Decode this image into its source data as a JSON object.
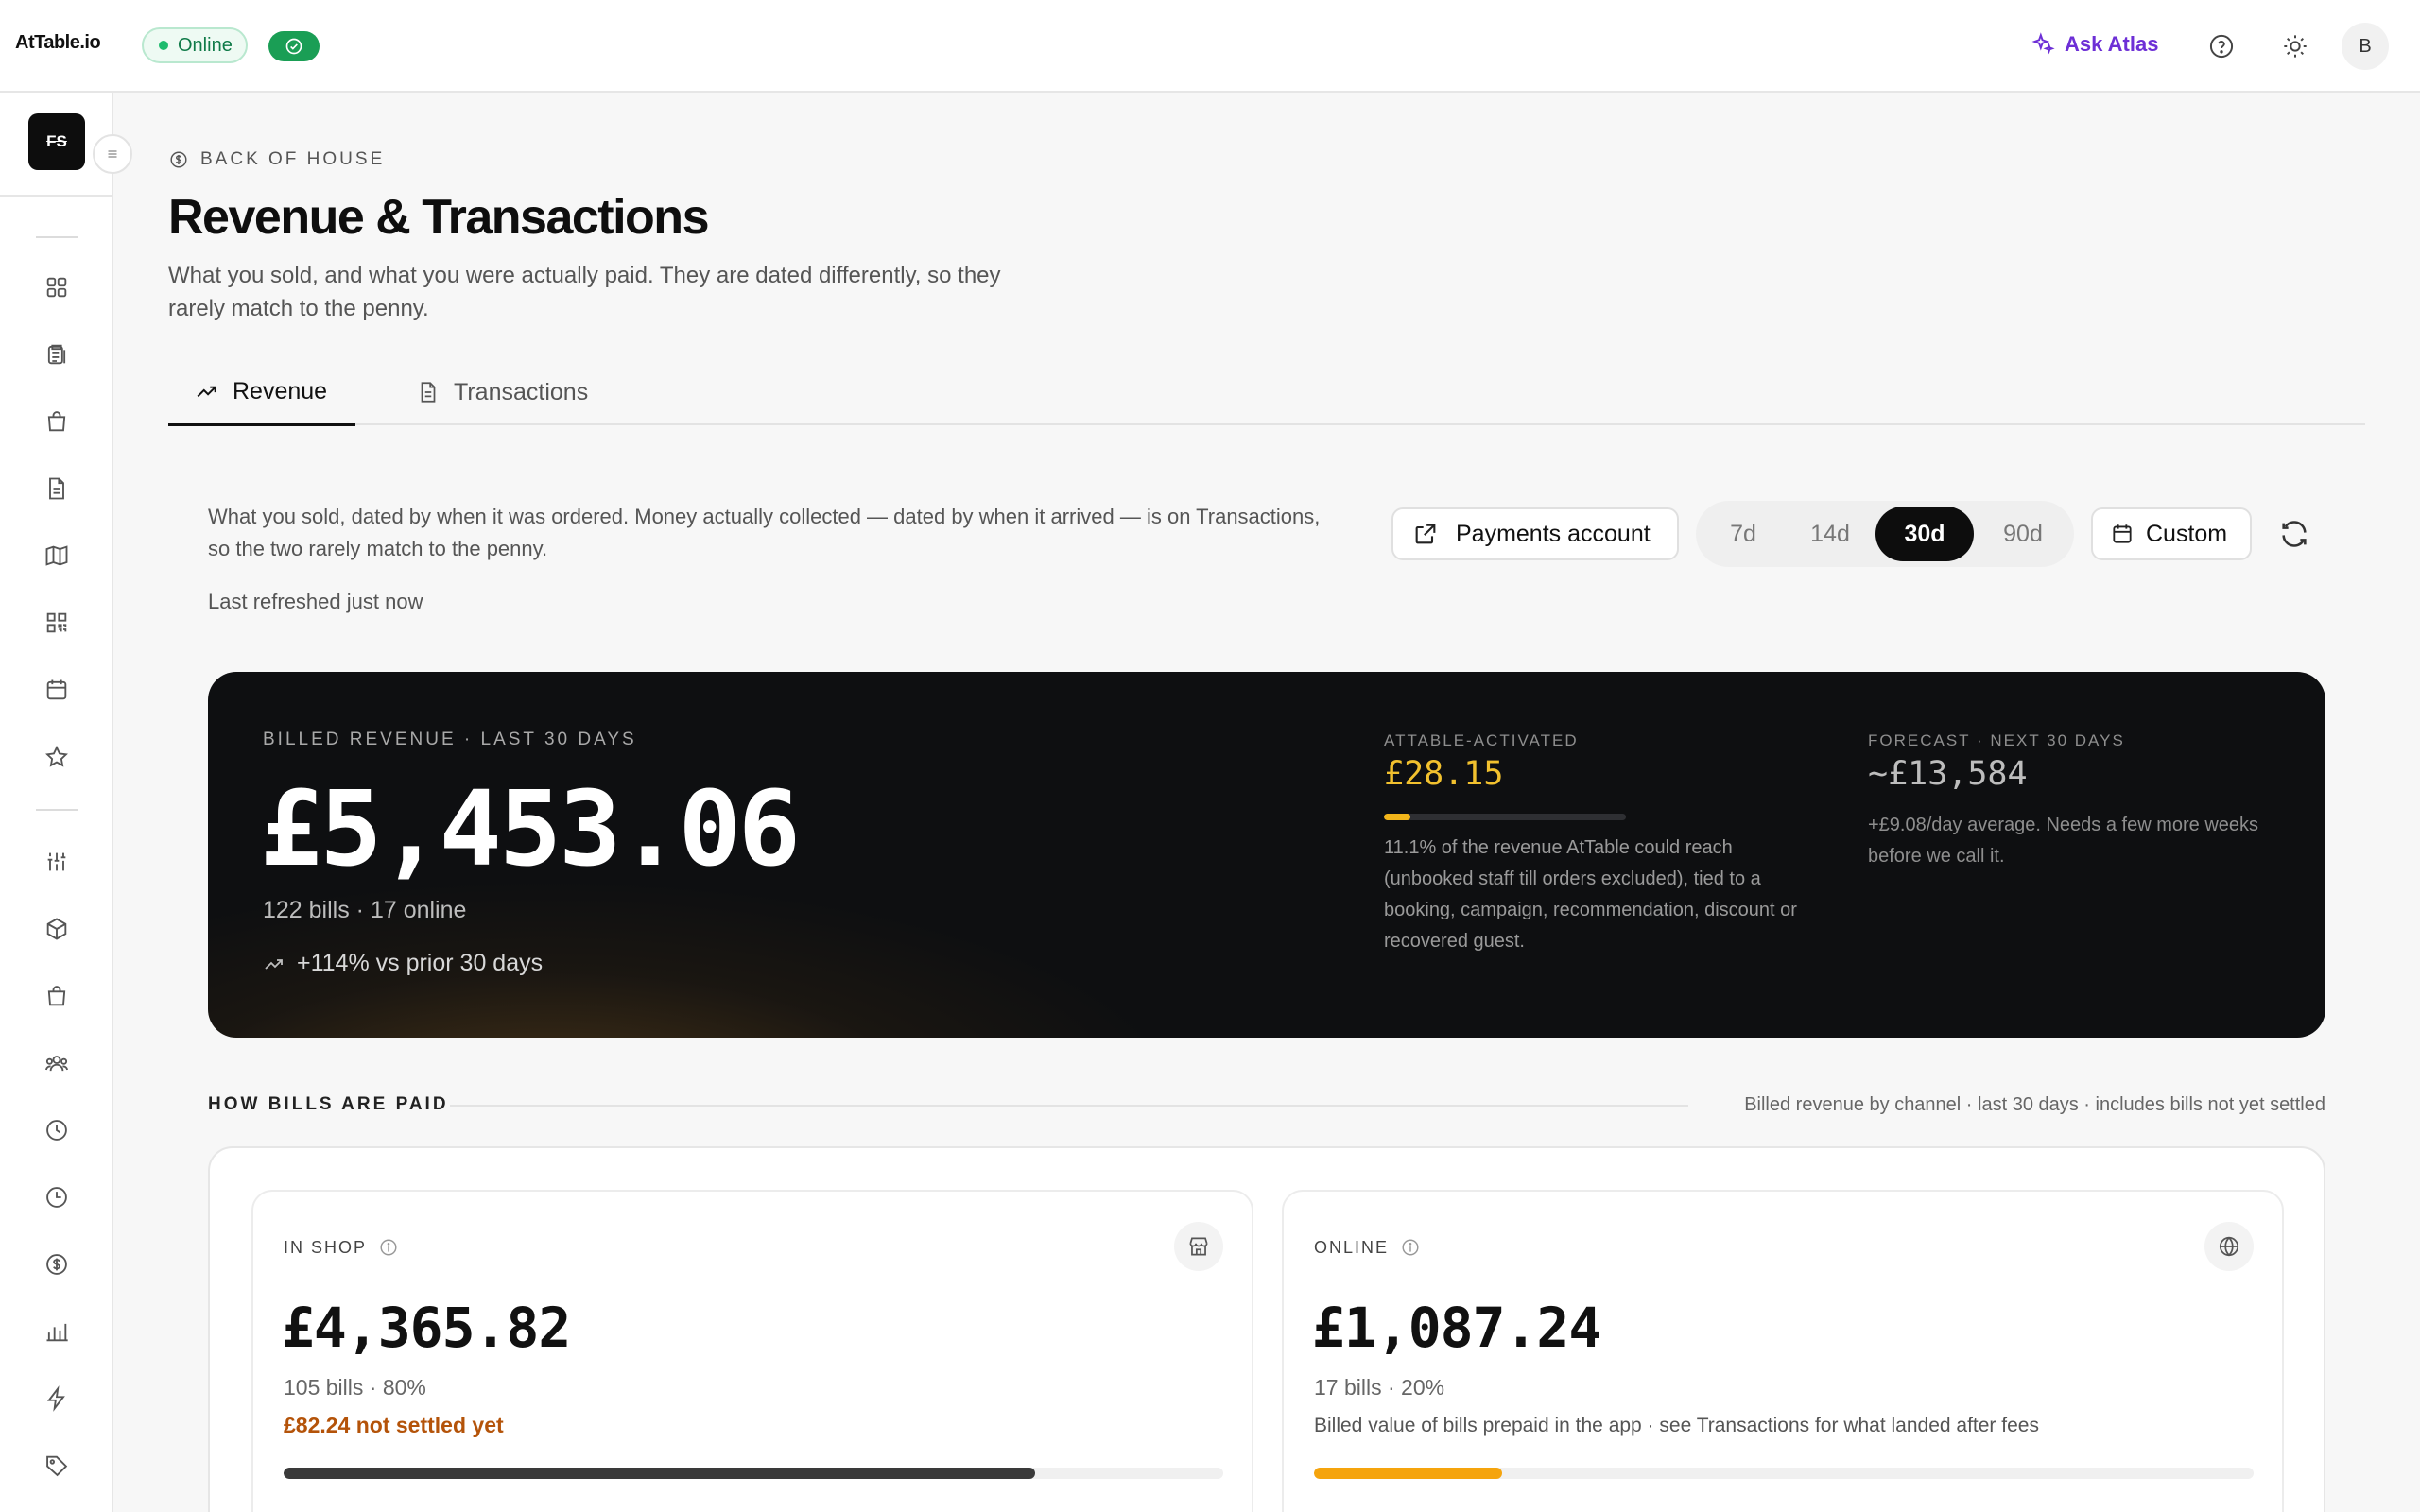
{
  "app": {
    "brand": "AtTable.io",
    "status_label": "Online",
    "ask_atlas_label": "Ask Atlas",
    "avatar_initial": "B",
    "logo_text": "FS"
  },
  "page": {
    "eyebrow": "BACK OF HOUSE",
    "title": "Revenue & Transactions",
    "subtitle": "What you sold, and what you were actually paid. They are dated differently, so they rarely match to the penny."
  },
  "tabs": [
    {
      "label": "Revenue",
      "active": true
    },
    {
      "label": "Transactions",
      "active": false
    }
  ],
  "revenue": {
    "intro": "What you sold, dated by when it was ordered. Money actually collected — dated by when it arrived — is on Transactions, so the two rarely match to the penny.",
    "last_refreshed": "Last refreshed just now",
    "payments_account_label": "Payments account",
    "ranges": [
      {
        "label": "7d",
        "active": false
      },
      {
        "label": "14d",
        "active": false
      },
      {
        "label": "30d",
        "active": true
      },
      {
        "label": "90d",
        "active": false
      }
    ],
    "custom_label": "Custom"
  },
  "hero": {
    "eyebrow": "BILLED REVENUE · LAST 30 DAYS",
    "value": "£5,453.06",
    "meta": "122 bills · 17 online",
    "trend": "+114% vs prior 30 days",
    "activated": {
      "eyebrow": "ATTABLE-ACTIVATED",
      "value": "£28.15",
      "share_percent": 11.1,
      "description": "11.1% of the revenue AtTable could reach (unbooked staff till orders excluded), tied to a booking, campaign, recommendation, discount or recovered guest."
    },
    "forecast": {
      "eyebrow": "FORECAST · NEXT 30 DAYS",
      "value": "~£13,584",
      "description": "+£9.08/day average. Needs a few more weeks before we call it."
    }
  },
  "channels": {
    "title": "HOW BILLS ARE PAID",
    "note": "Billed revenue by channel · last 30 days · includes bills not yet settled",
    "in_shop": {
      "label": "IN SHOP",
      "value": "£4,365.82",
      "meta": "105 bills · 80%",
      "warning": "£82.24 not settled yet",
      "share_percent": 80,
      "bar_color": "#3a3a3a"
    },
    "online": {
      "label": "ONLINE",
      "value": "£1,087.24",
      "meta": "17 bills · 20%",
      "note": "Billed value of bills prepaid in the app · see Transactions for what landed after fees",
      "share_percent": 20,
      "bar_color": "#f5a40d"
    }
  },
  "colors": {
    "accent_purple": "#6d2fd6",
    "online_green": "#1a9e55",
    "activated_gold": "#f2c12e",
    "warning_orange": "#b45309"
  }
}
